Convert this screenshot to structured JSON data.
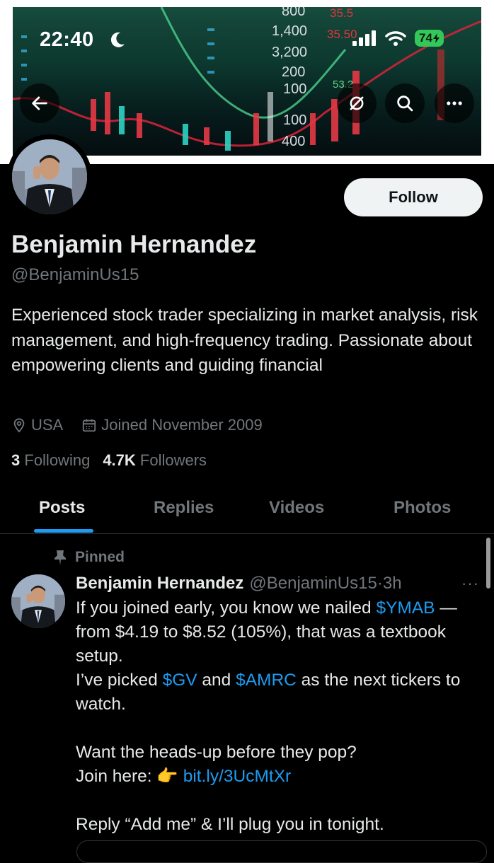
{
  "status_bar": {
    "time": "22:40",
    "battery": "74"
  },
  "banner": {
    "chart_numbers": [
      "800",
      "1,400",
      "3,200",
      "200",
      "100",
      "100",
      "400",
      "35.5",
      "35.50",
      "53.2"
    ]
  },
  "nav": {
    "back_icon": "arrow-left-icon",
    "hide_icon": "eye-slash-icon",
    "search_icon": "search-icon",
    "more_icon": "more-icon"
  },
  "profile": {
    "name": "Benjamin Hernandez",
    "handle": "@BenjaminUs15",
    "follow_label": "Follow",
    "bio": "Experienced stock trader specializing in market analysis, risk management, and high-frequency trading. Passionate about empowering clients and guiding financial",
    "location": "USA",
    "joined": "Joined November 2009",
    "following_count": "3",
    "following_label": "Following",
    "followers_count": "4.7K",
    "followers_label": "Followers"
  },
  "tabs": [
    "Posts",
    "Replies",
    "Videos",
    "Photos"
  ],
  "pinned_post": {
    "pinned_label": "Pinned",
    "author_name": "Benjamin Hernandez",
    "author_handle": "@BenjaminUs15",
    "separator": "·",
    "time": "3h",
    "more": "···",
    "line1_a": "If you joined early, you know we nailed ",
    "ticker1": "$YMAB",
    "line1_b": " — from $4.19 to $8.52 (105%), that was a textbook setup.",
    "line2_a": "I’ve picked ",
    "ticker2": "$GV",
    "line2_b": " and ",
    "ticker3": "$AMRC",
    "line2_c": " as the next tickers to watch.",
    "line3": "Want the heads-up before they pop?",
    "line4_a": "Join here: ",
    "emoji": "👉",
    "link": "bit.ly/3UcMtXr",
    "line5": "Reply “Add me” & I’ll plug you in tonight."
  }
}
